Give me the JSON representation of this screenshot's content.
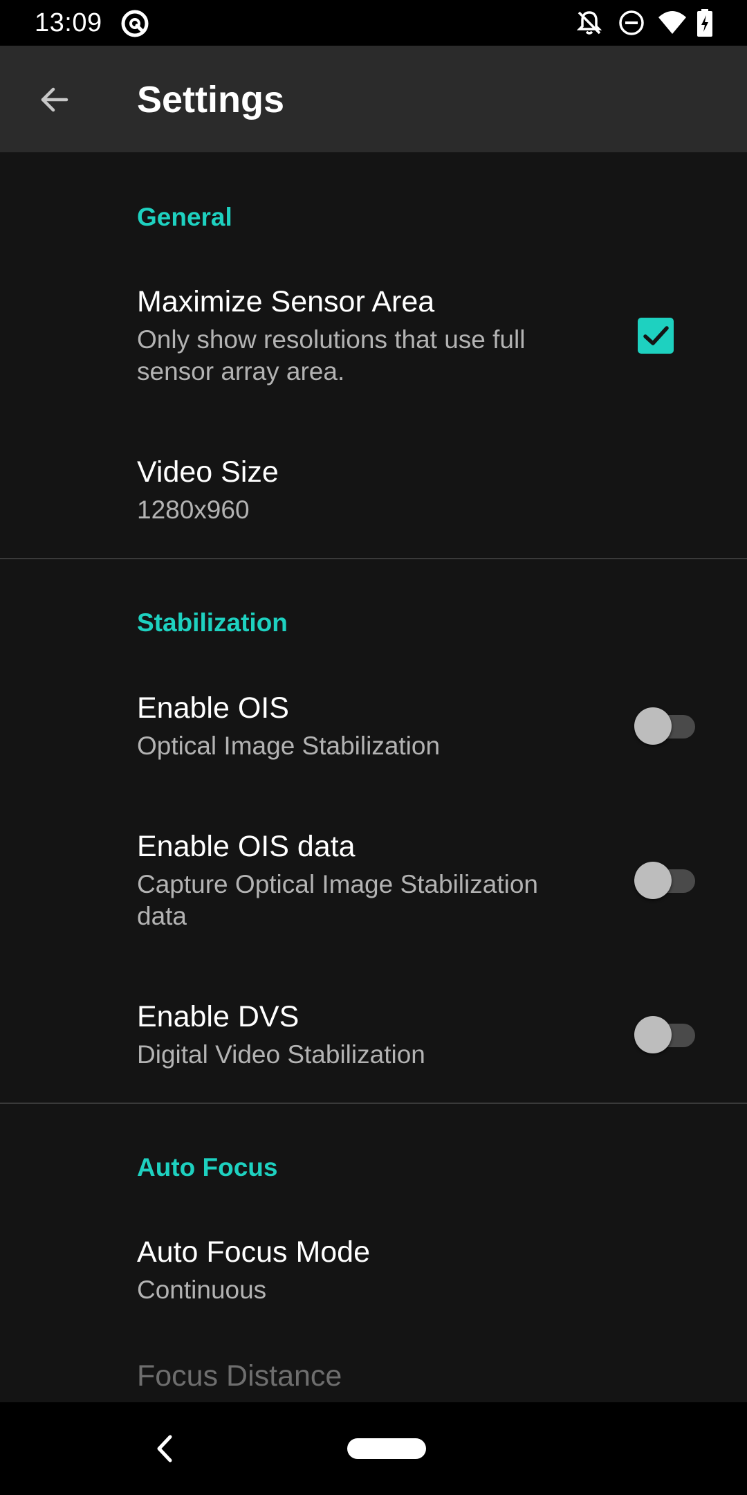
{
  "status_bar": {
    "time": "13:09",
    "icons": [
      "assistant-icon",
      "notifications-off-icon",
      "do-not-disturb-icon",
      "wifi-icon",
      "battery-charging-icon"
    ]
  },
  "app_bar": {
    "title": "Settings",
    "back_icon": "arrow-back-icon"
  },
  "colors": {
    "accent": "#1ed1c0",
    "background": "#141414",
    "app_bar": "#2b2b2b",
    "primary_text": "#ffffff",
    "secondary_text": "#b3b3b3"
  },
  "sections": {
    "general": {
      "header": "General",
      "maximize_sensor_area": {
        "title": "Maximize Sensor Area",
        "summary": "Only show resolutions that use full sensor array area.",
        "checked": true
      },
      "video_size": {
        "title": "Video Size",
        "summary": "1280x960"
      }
    },
    "stabilization": {
      "header": "Stabilization",
      "enable_ois": {
        "title": "Enable OIS",
        "summary": "Optical Image Stabilization",
        "on": false
      },
      "enable_ois_data": {
        "title": "Enable OIS data",
        "summary": "Capture Optical Image Stabilization data",
        "on": false
      },
      "enable_dvs": {
        "title": "Enable DVS",
        "summary": "Digital Video Stabilization",
        "on": false
      }
    },
    "auto_focus": {
      "header": "Auto Focus",
      "auto_focus_mode": {
        "title": "Auto Focus Mode",
        "summary": "Continuous"
      },
      "focus_distance": {
        "title": "Focus Distance",
        "enabled": false
      }
    }
  },
  "nav_bar": {
    "back_icon": "nav-back-icon",
    "home_icon": "nav-home-pill"
  }
}
